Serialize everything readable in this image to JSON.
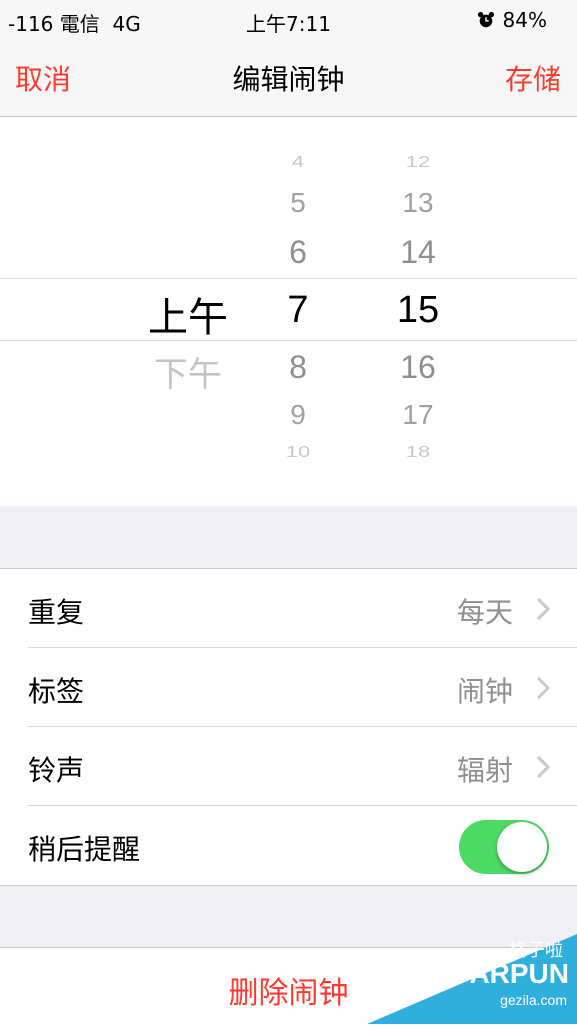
{
  "status": {
    "carrier": "-116 電信",
    "network": "4G",
    "time": "上午7:11",
    "battery": "84%",
    "alarm_icon": "alarm-clock-icon"
  },
  "nav": {
    "cancel": "取消",
    "title": "编辑闹钟",
    "save": "存储",
    "accent": "#ff3b30"
  },
  "picker": {
    "ampm": {
      "selected": "上午",
      "below": "下午"
    },
    "hours": [
      "4",
      "5",
      "6",
      "7",
      "8",
      "9",
      "10"
    ],
    "minutes": [
      "12",
      "13",
      "14",
      "15",
      "16",
      "17",
      "18"
    ],
    "selected_hour": "7",
    "selected_minute": "15"
  },
  "settings": {
    "repeat": {
      "label": "重复",
      "value": "每天"
    },
    "label": {
      "label": "标签",
      "value": "闹钟"
    },
    "sound": {
      "label": "铃声",
      "value": "辐射"
    },
    "snooze": {
      "label": "稍后提醒",
      "on": true,
      "color": "#4cd964"
    }
  },
  "delete_label": "删除闹钟",
  "watermark": {
    "brand": "ARPUN",
    "cn": "格子啦",
    "site": "gezila.com"
  }
}
